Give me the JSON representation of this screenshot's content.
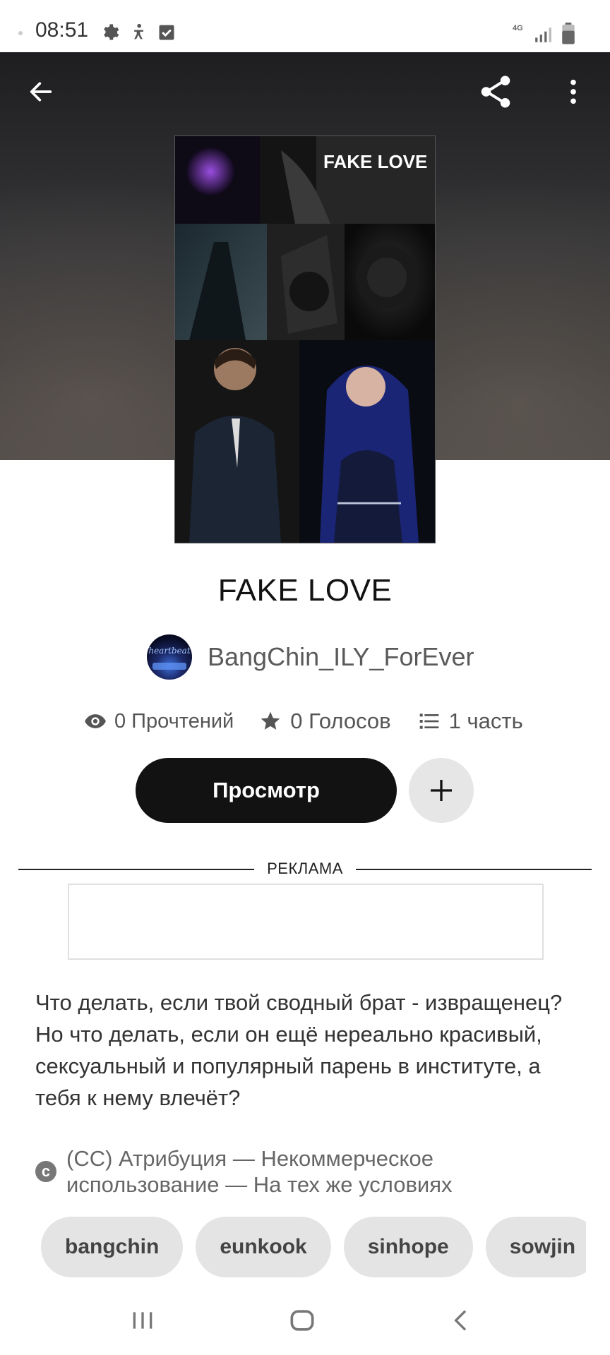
{
  "status_bar": {
    "time": "08:51",
    "network": "4G",
    "icons": [
      "settings-icon",
      "accessibility-icon",
      "checkbox-icon",
      "signal-icon",
      "battery-icon"
    ]
  },
  "header": {
    "icons": [
      "back-arrow-icon",
      "share-icon",
      "more-vert-icon"
    ]
  },
  "cover": {
    "text": "FAKE LOVE"
  },
  "story": {
    "title": "FAKE LOVE",
    "author": "BangChin_ILY_ForEver",
    "avatar_text": "heartbeat",
    "reads": "0 Прочтений",
    "votes": "0 Голосов",
    "parts": "1 часть",
    "read_button": "Просмотр",
    "description": "Что делать, если твой сводный брат - извращенец? Но что делать, если он ещё нереально красивый, сексуальный и популярный парень в институте, а тебя к нему влечёт?",
    "license": "(CC) Атрибуция — Некоммерческое использование — На тех же условиях"
  },
  "ad": {
    "label": "РЕКЛАМА"
  },
  "tags": [
    "bangchin",
    "eunkook",
    "sinhope",
    "sowjin"
  ],
  "colors": {
    "primary_button": "#121212",
    "secondary_button": "#e6e6e6",
    "tag_bg": "#e4e4e4",
    "hero_bg": "#343436"
  },
  "nav_bar": {
    "icons": [
      "recent-apps-icon",
      "home-icon",
      "back-icon"
    ]
  }
}
